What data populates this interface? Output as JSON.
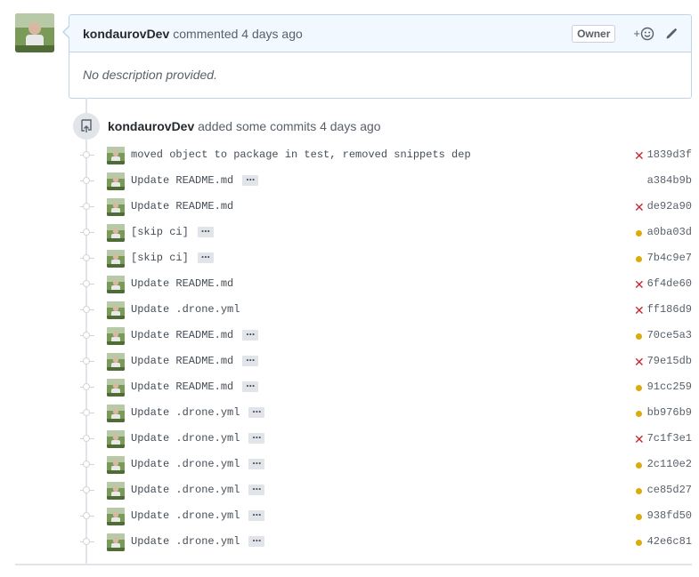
{
  "comment": {
    "author": "kondaurovDev",
    "action": "commented",
    "time": "4 days ago",
    "badge": "Owner",
    "reaction_plus": "+",
    "body": "No description provided."
  },
  "event": {
    "author": "kondaurovDev",
    "text": "added some commits",
    "time": "4 days ago"
  },
  "commits": [
    {
      "message": "moved object to package in test, removed snippets dep",
      "has_more": false,
      "status": "fail",
      "sha": "1839d3f"
    },
    {
      "message": "Update README.md",
      "has_more": true,
      "status": "none",
      "sha": "a384b9b"
    },
    {
      "message": "Update README.md",
      "has_more": false,
      "status": "fail",
      "sha": "de92a90"
    },
    {
      "message": "[skip ci]",
      "has_more": true,
      "status": "pending",
      "sha": "a0ba03d"
    },
    {
      "message": "[skip ci]",
      "has_more": true,
      "status": "pending",
      "sha": "7b4c9e7"
    },
    {
      "message": "Update README.md",
      "has_more": false,
      "status": "fail",
      "sha": "6f4de60"
    },
    {
      "message": "Update .drone.yml",
      "has_more": false,
      "status": "fail",
      "sha": "ff186d9"
    },
    {
      "message": "Update README.md",
      "has_more": true,
      "status": "pending",
      "sha": "70ce5a3"
    },
    {
      "message": "Update README.md",
      "has_more": true,
      "status": "fail",
      "sha": "79e15db"
    },
    {
      "message": "Update README.md",
      "has_more": true,
      "status": "pending",
      "sha": "91cc259"
    },
    {
      "message": "Update .drone.yml",
      "has_more": true,
      "status": "pending",
      "sha": "bb976b9"
    },
    {
      "message": "Update .drone.yml",
      "has_more": true,
      "status": "fail",
      "sha": "7c1f3e1"
    },
    {
      "message": "Update .drone.yml",
      "has_more": true,
      "status": "pending",
      "sha": "2c110e2"
    },
    {
      "message": "Update .drone.yml",
      "has_more": true,
      "status": "pending",
      "sha": "ce85d27"
    },
    {
      "message": "Update .drone.yml",
      "has_more": true,
      "status": "pending",
      "sha": "938fd50"
    },
    {
      "message": "Update .drone.yml",
      "has_more": true,
      "status": "pending",
      "sha": "42e6c81"
    }
  ],
  "ellipsis_label": "…",
  "fail_glyph": "✕",
  "colors": {
    "fail": "#cb2431",
    "pending": "#dbab09",
    "header_bg": "#f1f8ff",
    "header_border": "#c0d3eb"
  }
}
